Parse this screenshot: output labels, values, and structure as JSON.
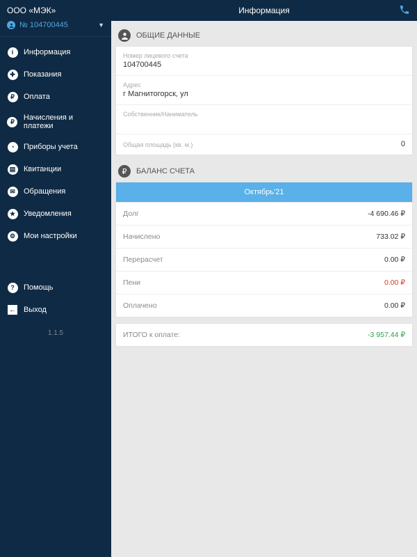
{
  "sidebar": {
    "org": "ООО «МЭК»",
    "account_number": "№ 104700445",
    "version": "1.1.5",
    "items": [
      {
        "label": "Информация",
        "glyph": "i"
      },
      {
        "label": "Показания",
        "glyph": "✚"
      },
      {
        "label": "Оплата",
        "glyph": "₽"
      },
      {
        "label": "Начисления и платежи",
        "glyph": "₽"
      },
      {
        "label": "Приборы учета",
        "glyph": "◔"
      },
      {
        "label": "Квитанции",
        "glyph": "▤"
      },
      {
        "label": "Обращения",
        "glyph": "✉"
      },
      {
        "label": "Уведомления",
        "glyph": "★"
      },
      {
        "label": "Мои настройки",
        "glyph": "⚙"
      }
    ],
    "extra": [
      {
        "label": "Помощь",
        "glyph": "?"
      },
      {
        "label": "Выход",
        "glyph": "←"
      }
    ]
  },
  "topbar": {
    "title": "Информация"
  },
  "general": {
    "heading": "ОБЩИЕ ДАННЫЕ",
    "account_label": "Номер лицевого счета",
    "account_value": "104700445",
    "address_label": "Адрес",
    "address_value": "г Магнитогорск, ул",
    "owner_label": "Собственник/Наниматель",
    "owner_value": "",
    "area_label": "Общая площадь (кв. м.)",
    "area_value": "0"
  },
  "balance": {
    "heading": "БАЛАНС СЧЕТА",
    "period": "Октябрь'21",
    "rows": [
      {
        "label": "Долг",
        "value": "-4 690.46 ₽",
        "cls": ""
      },
      {
        "label": "Начислено",
        "value": "733.02 ₽",
        "cls": ""
      },
      {
        "label": "Перерасчет",
        "value": "0.00 ₽",
        "cls": ""
      },
      {
        "label": "Пени",
        "value": "0.00 ₽",
        "cls": "red"
      },
      {
        "label": "Оплачено",
        "value": "0.00 ₽",
        "cls": ""
      }
    ],
    "total_label": "ИТОГО к оплате:",
    "total_value": "-3 957.44 ₽"
  }
}
